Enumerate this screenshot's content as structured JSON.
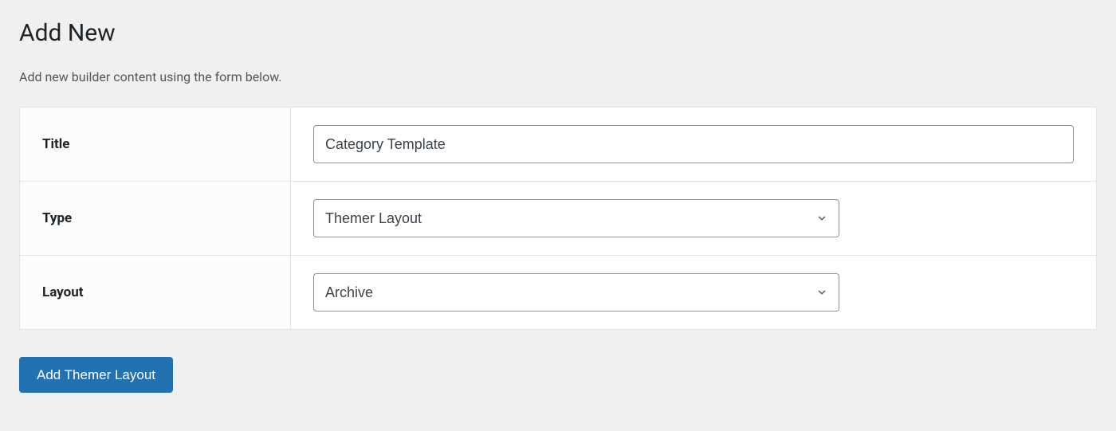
{
  "header": {
    "title": "Add New",
    "description": "Add new builder content using the form below."
  },
  "form": {
    "title": {
      "label": "Title",
      "value": "Category Template"
    },
    "type": {
      "label": "Type",
      "value": "Themer Layout"
    },
    "layout": {
      "label": "Layout",
      "value": "Archive"
    }
  },
  "submit": {
    "label": "Add Themer Layout"
  }
}
